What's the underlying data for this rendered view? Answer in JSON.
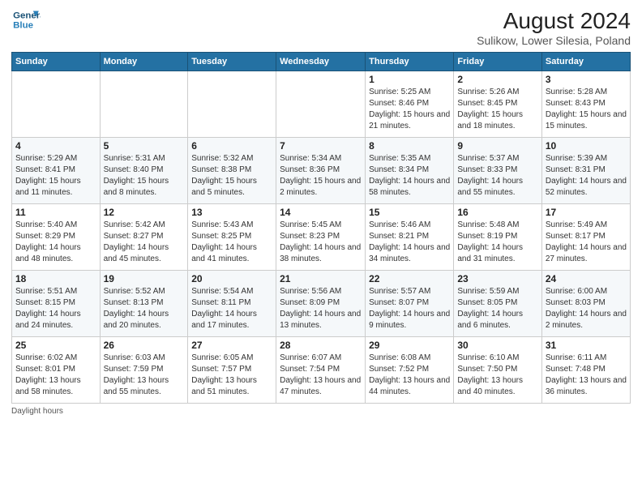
{
  "logo": {
    "line1": "General",
    "line2": "Blue"
  },
  "title": "August 2024",
  "subtitle": "Sulikow, Lower Silesia, Poland",
  "days_of_week": [
    "Sunday",
    "Monday",
    "Tuesday",
    "Wednesday",
    "Thursday",
    "Friday",
    "Saturday"
  ],
  "weeks": [
    [
      {
        "day": "",
        "info": ""
      },
      {
        "day": "",
        "info": ""
      },
      {
        "day": "",
        "info": ""
      },
      {
        "day": "",
        "info": ""
      },
      {
        "day": "1",
        "info": "Sunrise: 5:25 AM\nSunset: 8:46 PM\nDaylight: 15 hours and 21 minutes."
      },
      {
        "day": "2",
        "info": "Sunrise: 5:26 AM\nSunset: 8:45 PM\nDaylight: 15 hours and 18 minutes."
      },
      {
        "day": "3",
        "info": "Sunrise: 5:28 AM\nSunset: 8:43 PM\nDaylight: 15 hours and 15 minutes."
      }
    ],
    [
      {
        "day": "4",
        "info": "Sunrise: 5:29 AM\nSunset: 8:41 PM\nDaylight: 15 hours and 11 minutes."
      },
      {
        "day": "5",
        "info": "Sunrise: 5:31 AM\nSunset: 8:40 PM\nDaylight: 15 hours and 8 minutes."
      },
      {
        "day": "6",
        "info": "Sunrise: 5:32 AM\nSunset: 8:38 PM\nDaylight: 15 hours and 5 minutes."
      },
      {
        "day": "7",
        "info": "Sunrise: 5:34 AM\nSunset: 8:36 PM\nDaylight: 15 hours and 2 minutes."
      },
      {
        "day": "8",
        "info": "Sunrise: 5:35 AM\nSunset: 8:34 PM\nDaylight: 14 hours and 58 minutes."
      },
      {
        "day": "9",
        "info": "Sunrise: 5:37 AM\nSunset: 8:33 PM\nDaylight: 14 hours and 55 minutes."
      },
      {
        "day": "10",
        "info": "Sunrise: 5:39 AM\nSunset: 8:31 PM\nDaylight: 14 hours and 52 minutes."
      }
    ],
    [
      {
        "day": "11",
        "info": "Sunrise: 5:40 AM\nSunset: 8:29 PM\nDaylight: 14 hours and 48 minutes."
      },
      {
        "day": "12",
        "info": "Sunrise: 5:42 AM\nSunset: 8:27 PM\nDaylight: 14 hours and 45 minutes."
      },
      {
        "day": "13",
        "info": "Sunrise: 5:43 AM\nSunset: 8:25 PM\nDaylight: 14 hours and 41 minutes."
      },
      {
        "day": "14",
        "info": "Sunrise: 5:45 AM\nSunset: 8:23 PM\nDaylight: 14 hours and 38 minutes."
      },
      {
        "day": "15",
        "info": "Sunrise: 5:46 AM\nSunset: 8:21 PM\nDaylight: 14 hours and 34 minutes."
      },
      {
        "day": "16",
        "info": "Sunrise: 5:48 AM\nSunset: 8:19 PM\nDaylight: 14 hours and 31 minutes."
      },
      {
        "day": "17",
        "info": "Sunrise: 5:49 AM\nSunset: 8:17 PM\nDaylight: 14 hours and 27 minutes."
      }
    ],
    [
      {
        "day": "18",
        "info": "Sunrise: 5:51 AM\nSunset: 8:15 PM\nDaylight: 14 hours and 24 minutes."
      },
      {
        "day": "19",
        "info": "Sunrise: 5:52 AM\nSunset: 8:13 PM\nDaylight: 14 hours and 20 minutes."
      },
      {
        "day": "20",
        "info": "Sunrise: 5:54 AM\nSunset: 8:11 PM\nDaylight: 14 hours and 17 minutes."
      },
      {
        "day": "21",
        "info": "Sunrise: 5:56 AM\nSunset: 8:09 PM\nDaylight: 14 hours and 13 minutes."
      },
      {
        "day": "22",
        "info": "Sunrise: 5:57 AM\nSunset: 8:07 PM\nDaylight: 14 hours and 9 minutes."
      },
      {
        "day": "23",
        "info": "Sunrise: 5:59 AM\nSunset: 8:05 PM\nDaylight: 14 hours and 6 minutes."
      },
      {
        "day": "24",
        "info": "Sunrise: 6:00 AM\nSunset: 8:03 PM\nDaylight: 14 hours and 2 minutes."
      }
    ],
    [
      {
        "day": "25",
        "info": "Sunrise: 6:02 AM\nSunset: 8:01 PM\nDaylight: 13 hours and 58 minutes."
      },
      {
        "day": "26",
        "info": "Sunrise: 6:03 AM\nSunset: 7:59 PM\nDaylight: 13 hours and 55 minutes."
      },
      {
        "day": "27",
        "info": "Sunrise: 6:05 AM\nSunset: 7:57 PM\nDaylight: 13 hours and 51 minutes."
      },
      {
        "day": "28",
        "info": "Sunrise: 6:07 AM\nSunset: 7:54 PM\nDaylight: 13 hours and 47 minutes."
      },
      {
        "day": "29",
        "info": "Sunrise: 6:08 AM\nSunset: 7:52 PM\nDaylight: 13 hours and 44 minutes."
      },
      {
        "day": "30",
        "info": "Sunrise: 6:10 AM\nSunset: 7:50 PM\nDaylight: 13 hours and 40 minutes."
      },
      {
        "day": "31",
        "info": "Sunrise: 6:11 AM\nSunset: 7:48 PM\nDaylight: 13 hours and 36 minutes."
      }
    ]
  ],
  "footer": "Daylight hours"
}
